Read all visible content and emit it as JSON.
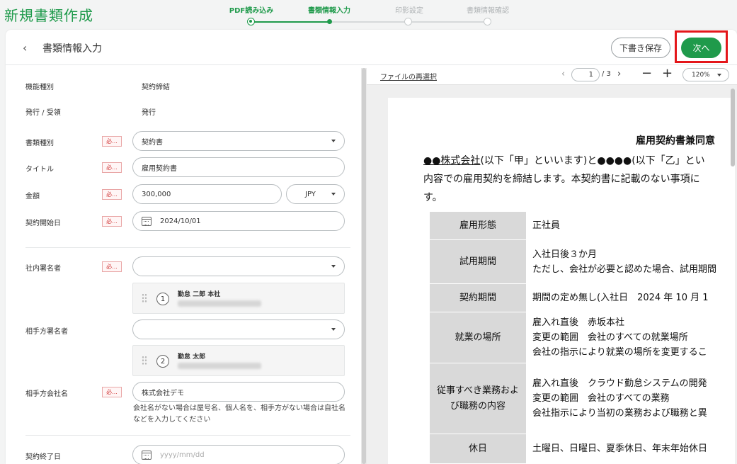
{
  "app": {
    "title": "新規書類作成"
  },
  "stepper": [
    {
      "label": "PDF読み込み",
      "state": "done"
    },
    {
      "label": "書類情報入力",
      "state": "active"
    },
    {
      "label": "印影設定",
      "state": "pending"
    },
    {
      "label": "書類情報確認",
      "state": "pending"
    }
  ],
  "header": {
    "title": "書類情報入力",
    "draft_label": "下書き保存",
    "next_label": "次へ"
  },
  "colors": {
    "brand": "#1f9a4b",
    "highlight": "#e4161a",
    "required": "#d23c3c"
  },
  "form": {
    "required_label": "必...",
    "function_type": {
      "label": "機能種別",
      "value": "契約締結"
    },
    "issue": {
      "label": "発行 / 受領",
      "value": "発行"
    },
    "doc_type": {
      "label": "書類種別",
      "value": "契約書"
    },
    "doc_title": {
      "label": "タイトル",
      "value": "雇用契約書"
    },
    "amount": {
      "label": "金額",
      "value": "300,000",
      "currency": "JPY"
    },
    "start_date": {
      "label": "契約開始日",
      "value": "2024/10/01"
    },
    "internal_signer": {
      "label": "社内署名者",
      "value": "",
      "index": "1",
      "name": "勤怠 二郎 本社"
    },
    "partner_signer": {
      "label": "相手方署名者",
      "value": "",
      "index": "2",
      "name": "勤怠 太郎"
    },
    "partner_company": {
      "label": "相手方会社名",
      "value": "株式会社デモ",
      "help": "会社名がない場合は屋号名、個人名を、相手方がない場合は自社名などを入力してください"
    },
    "end_date": {
      "label": "契約終了日",
      "placeholder": "yyyy/mm/dd"
    }
  },
  "preview": {
    "reselect_label": "ファイルの再選択",
    "page_current": "1",
    "page_total": "/ 3",
    "zoom": "120%",
    "document": {
      "title": "雇用契約書兼同意",
      "intro_company": "●●株式会社",
      "intro_line1_rest": "(以下「甲」といいます)と●●●●(以下「乙」とい",
      "intro_line2": "内容での雇用契約を締結します。本契約書に記載のない事項に",
      "intro_line3": "す。",
      "rows": [
        {
          "head": "雇用形態",
          "lines": [
            "正社員"
          ]
        },
        {
          "head": "試用期間",
          "lines": [
            "入社日後３か月",
            "ただし、会社が必要と認めた場合、試用期間"
          ]
        },
        {
          "head": "契約期間",
          "lines": [
            "期間の定め無し(入社日　2024 年 10 月 1"
          ]
        },
        {
          "head": "就業の場所",
          "lines": [
            "雇入れ直後　赤坂本社",
            "変更の範囲　会社のすべての就業場所",
            "会社の指示により就業の場所を変更するこ"
          ]
        },
        {
          "head": "従事すべき業務および職務の内容",
          "lines": [
            "雇入れ直後　クラウド勤怠システムの開発",
            "変更の範囲　会社のすべての業務",
            "会社指示により当初の業務および職務と異"
          ]
        },
        {
          "head": "休日",
          "lines": [
            "土曜日、日曜日、夏季休日、年末年始休日"
          ]
        }
      ]
    }
  }
}
